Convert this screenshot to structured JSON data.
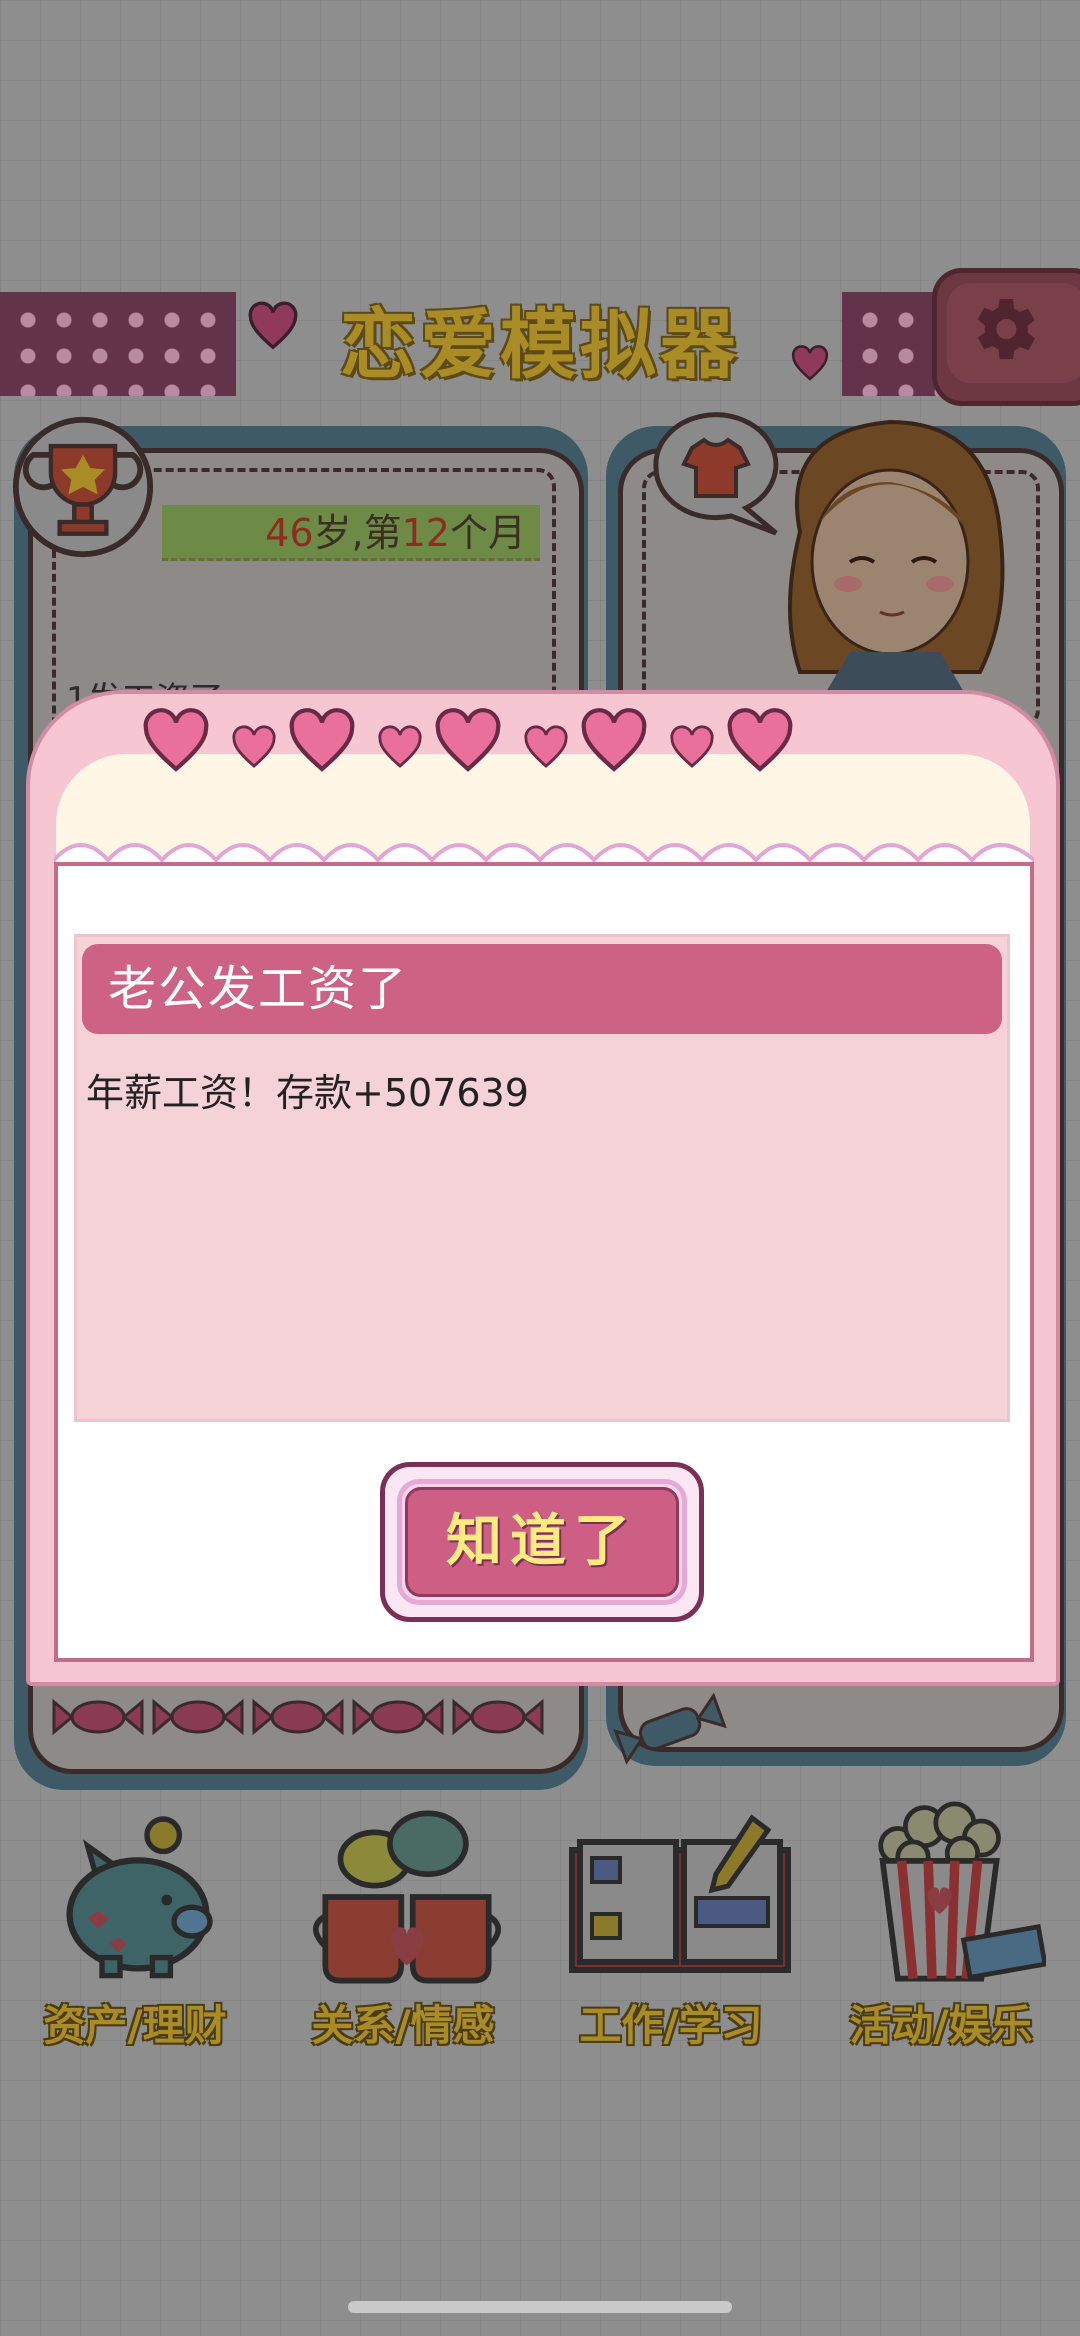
{
  "header": {
    "title": "恋爱模拟器",
    "settings_icon": "gear-icon"
  },
  "status": {
    "age": "46",
    "age_unit": "岁,第",
    "month": "12",
    "month_unit": "个月",
    "log_partial": "1发工资了"
  },
  "menu": {
    "items": [
      {
        "label": "资产/理财",
        "icon": "piggy-bank-icon"
      },
      {
        "label": "关系/情感",
        "icon": "coffee-cups-icon"
      },
      {
        "label": "工作/学习",
        "icon": "notebook-icon"
      },
      {
        "label": "活动/娱乐",
        "icon": "popcorn-icon"
      }
    ]
  },
  "dialog": {
    "title": "老公发工资了",
    "message": "年薪工资！存款+507639",
    "confirm_label": "知道了"
  },
  "colors": {
    "dialog_title_bg": "#cd6285",
    "dialog_body_bg": "#f5d2d8",
    "button_face": "#cd5f84",
    "button_text": "#ffec80",
    "overlay": "#8e8e8e"
  }
}
